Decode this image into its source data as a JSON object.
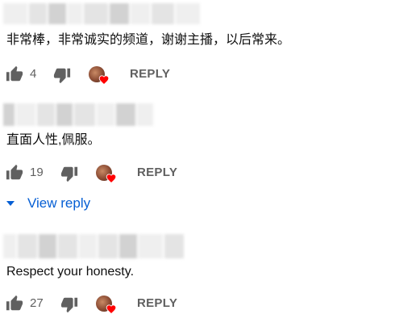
{
  "comments": [
    {
      "text": "非常棒，非常诚实的频道，谢谢主播，以后常来。",
      "likes": "4",
      "reply_label": "REPLY"
    },
    {
      "text": "直面人性,佩服。",
      "likes": "19",
      "reply_label": "REPLY",
      "view_replies_label": "View reply"
    },
    {
      "text": "Respect your honesty.",
      "likes": "27",
      "reply_label": "REPLY"
    }
  ],
  "colors": {
    "heart": "#ff0000",
    "link": "#065fd4",
    "secondary_text": "#606060"
  },
  "icons": {
    "like": "thumb-up-icon",
    "dislike": "thumb-down-icon",
    "creator_heart": "creator-heart-icon",
    "expand": "caret-down-icon"
  }
}
